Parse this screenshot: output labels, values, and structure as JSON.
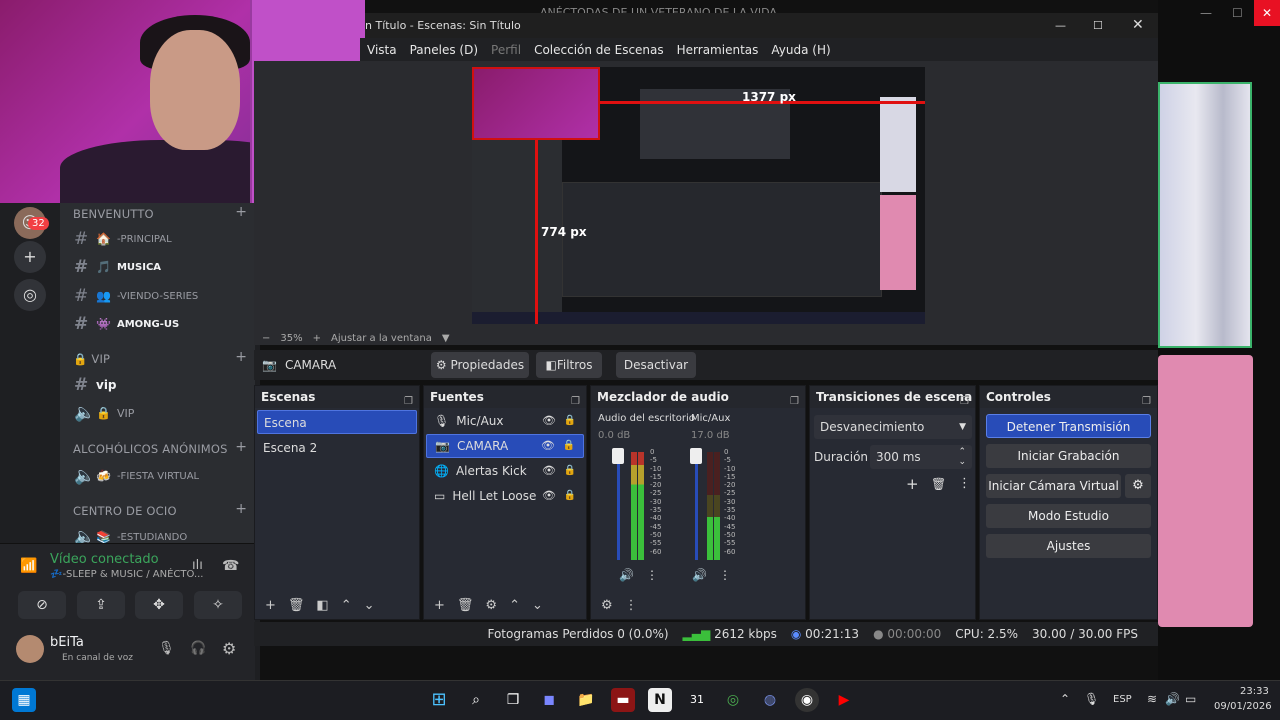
{
  "obs": {
    "title": "n Título - Escenas: Sin Título",
    "bg_title": "ANÉCTODAS DE UN VETERANO DE LA VIDA",
    "menu": [
      {
        "label": "Vista",
        "dim": false
      },
      {
        "label": "Paneles (D)",
        "dim": false
      },
      {
        "label": "Perfil",
        "dim": true
      },
      {
        "label": "Colección de Escenas",
        "dim": false
      },
      {
        "label": "Herramientas",
        "dim": false
      },
      {
        "label": "Ayuda (H)",
        "dim": false
      }
    ],
    "preview": {
      "label_h": "1377 px",
      "label_v": "774 px"
    },
    "zoom": {
      "minus": "−",
      "value": "35%",
      "plus": "+",
      "fit": "Ajustar a la ventana"
    },
    "source_bar": {
      "name": "CAMARA",
      "properties": "Propiedades",
      "filters": "Filtros",
      "deactivate": "Desactivar"
    },
    "scenes": {
      "title": "Escenas",
      "items": [
        "Escena",
        "Escena 2"
      ],
      "selected": 0
    },
    "sources": {
      "title": "Fuentes",
      "items": [
        {
          "name": "Mic/Aux",
          "icon": "mic-icon"
        },
        {
          "name": "CAMARA",
          "icon": "camera-icon"
        },
        {
          "name": "Alertas Kick",
          "icon": "globe-icon"
        },
        {
          "name": "Hell Let Loose",
          "icon": "monitor-icon"
        }
      ],
      "selected": 1
    },
    "mixer": {
      "title": "Mezclador de audio",
      "channels": [
        {
          "name": "Audio del escritorio",
          "db": "0.0 dB",
          "level": 0.85
        },
        {
          "name": "Mic/Aux",
          "db": "17.0 dB",
          "level": 0.45
        }
      ],
      "scale": [
        "0",
        "-5",
        "-10",
        "-15",
        "-20",
        "-25",
        "-30",
        "-35",
        "-40",
        "-45",
        "-50",
        "-55",
        "-60"
      ]
    },
    "transitions": {
      "title": "Transiciones de escena",
      "selected": "Desvanecimiento",
      "duration_label": "Duración",
      "duration": "300 ms"
    },
    "controls": {
      "title": "Controles",
      "buttons": [
        "Detener Transmisión",
        "Iniciar Grabación",
        "Iniciar Cámara Virtual",
        "Modo Estudio",
        "Ajustes"
      ]
    },
    "status": {
      "dropped": "Fotogramas Perdidos 0 (0.0%)",
      "kbps": "2612 kbps",
      "live_time": "00:21:13",
      "rec_time": "00:00:00",
      "cpu": "CPU: 2.5%",
      "fps": "30.00 / 30.00 FPS"
    }
  },
  "discord": {
    "badge": "32",
    "categories": [
      {
        "name": "BENVENUTTO",
        "channels": [
          {
            "name": "-PRINCIPAL",
            "emoji": "🏠",
            "bold": false
          },
          {
            "name": "MUSICA",
            "emoji": "🎵",
            "bold": true
          },
          {
            "name": "-VIENDO-SERIES",
            "emoji": "👥",
            "bold": false
          },
          {
            "name": "AMONG-US",
            "emoji": "👾",
            "bold": true
          }
        ]
      },
      {
        "name": "🔒 VIP",
        "channels": [
          {
            "name": "vip",
            "emoji": "",
            "bold": true
          },
          {
            "name": "VIP",
            "emoji": "🔒",
            "bold": false
          }
        ]
      },
      {
        "name": "ALCOHÓLICOS ANÓNIMOS",
        "channels": [
          {
            "name": "-FIESTA VIRTUAL",
            "emoji": "🍻",
            "bold": false
          }
        ]
      },
      {
        "name": "CENTRO DE OCIO",
        "channels": [
          {
            "name": "-ESTUDIANDO",
            "emoji": "📚",
            "bold": false
          }
        ]
      }
    ],
    "voice": {
      "status": "Vídeo conectado",
      "channel": "💤-SLEEP & MUSIC / ANÉCTO..."
    },
    "user": {
      "name": "bEiTa",
      "status": "En canal de voz"
    }
  },
  "taskbar": {
    "lang": "ESP",
    "time": "23:33",
    "date": "09/01/2026"
  },
  "colors": {
    "accent": "#284cb8",
    "live_green": "#3bbf3b",
    "discord_bg": "#2b2d31"
  }
}
